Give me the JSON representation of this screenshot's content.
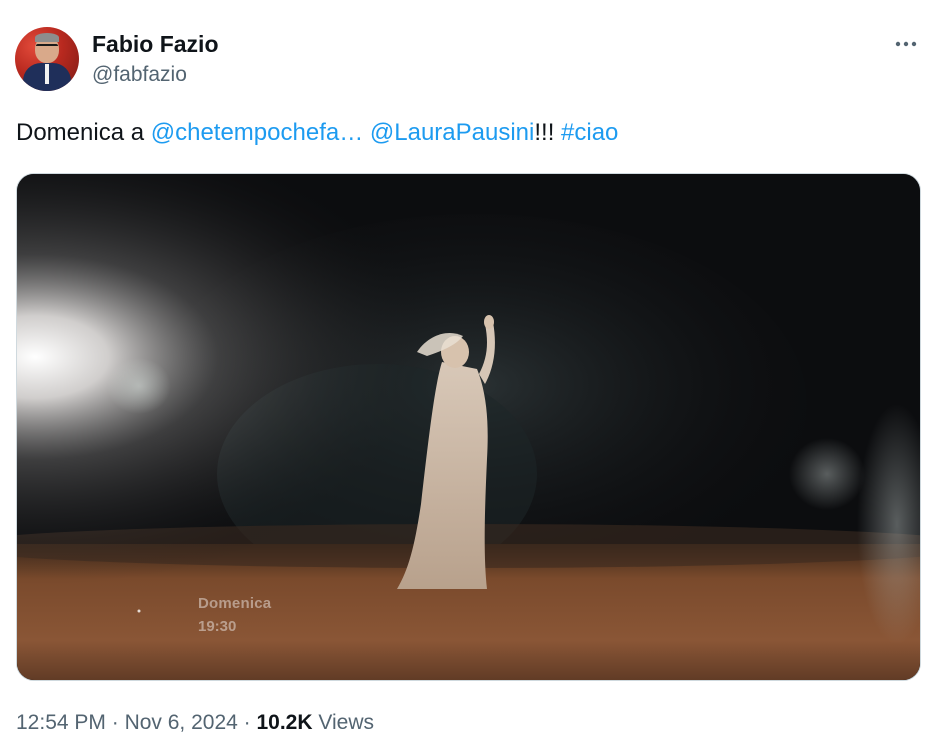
{
  "author": {
    "name": "Fabio Fazio",
    "handle": "@fabfazio"
  },
  "header": {
    "more_icon": "more-horizontal-icon"
  },
  "tweet": {
    "text_prefix": "Domenica a ",
    "mention_1": "@chetempochefa…",
    "mention_2": "@LauraPausini",
    "punct": "!!! ",
    "hashtag": "#ciao"
  },
  "media": {
    "overlay_day": "Domenica",
    "overlay_time": "19:30"
  },
  "footer": {
    "time": "12:54 PM",
    "separator_1": " · ",
    "date": "Nov 6, 2024",
    "separator_2": " · ",
    "views_count": "10.2K",
    "views_label": " Views"
  },
  "colors": {
    "link": "#1d9bf0",
    "text": "#0f1419",
    "secondary": "#536471"
  }
}
